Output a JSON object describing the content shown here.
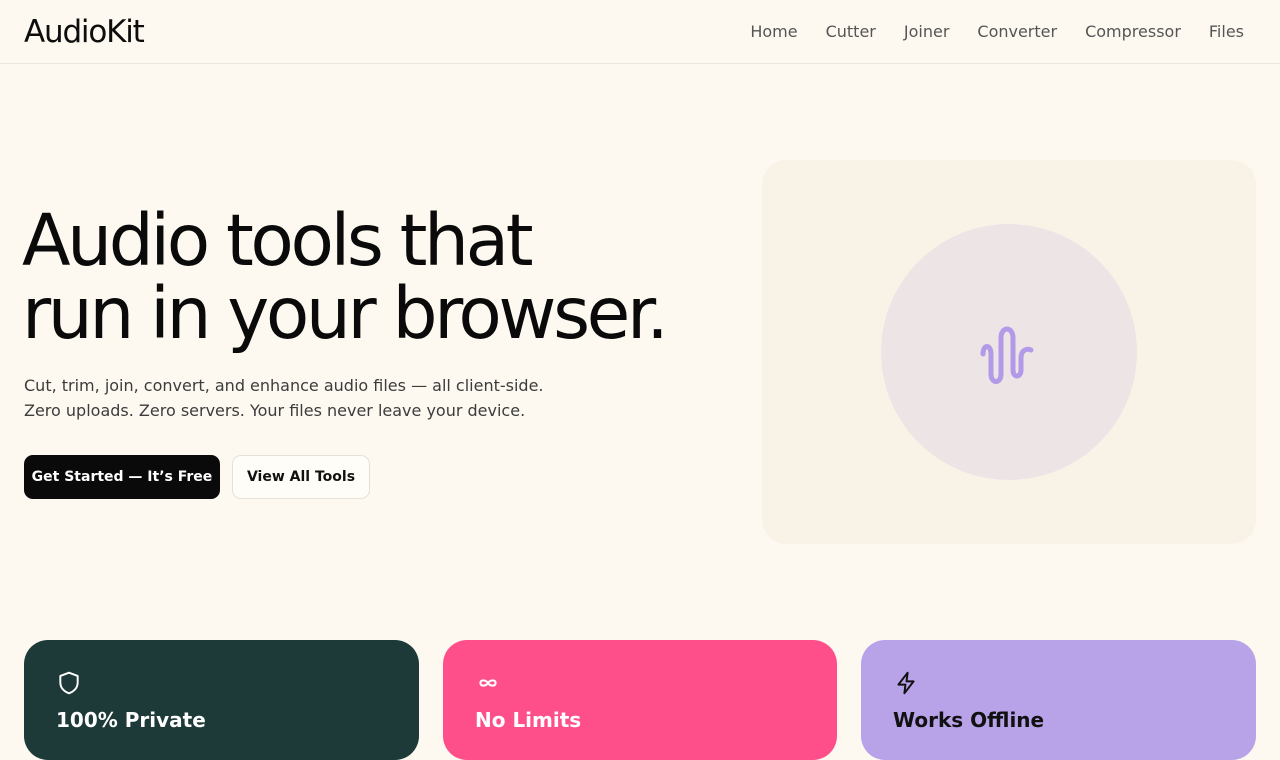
{
  "header": {
    "logo": "AudioKit",
    "nav": [
      "Home",
      "Cutter",
      "Joiner",
      "Converter",
      "Compressor",
      "Files"
    ]
  },
  "hero": {
    "title_line1": "Audio tools that",
    "title_line2": "run in your browser.",
    "subtitle_line1": "Cut, trim, join, convert, and enhance audio files — all client-side.",
    "subtitle_line2": "Zero uploads. Zero servers. Your files never leave your device.",
    "primary_button": "Get Started — It’s Free",
    "secondary_button": "View All Tools",
    "art_icon": "waveform-icon"
  },
  "features": [
    {
      "icon": "shield-icon",
      "title": "100% Private"
    },
    {
      "icon": "infinity-icon",
      "title": "No Limits"
    },
    {
      "icon": "lightning-icon",
      "title": "Works Offline"
    }
  ],
  "colors": {
    "background": "#fdf9f1",
    "primary_button": "#0a0a0a",
    "card_private": "#1d3a38",
    "card_limits": "#ff4f8b",
    "card_offline": "#b8a3e9",
    "waveform": "#b39ae8"
  }
}
